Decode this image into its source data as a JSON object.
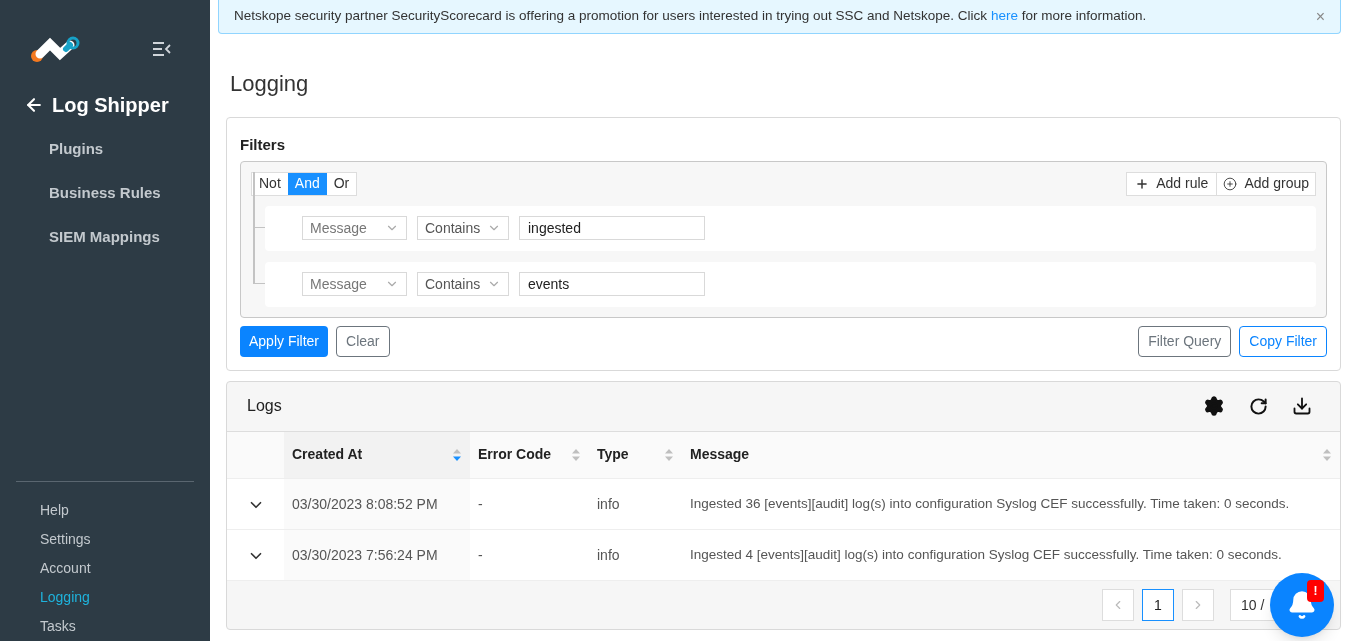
{
  "sidebar": {
    "back_title": "Log Shipper",
    "items": [
      {
        "label": "Plugins"
      },
      {
        "label": "Business Rules"
      },
      {
        "label": "SIEM Mappings"
      }
    ],
    "bottom_items": [
      {
        "label": "Help",
        "selected": false
      },
      {
        "label": "Settings",
        "selected": false
      },
      {
        "label": "Account",
        "selected": false
      },
      {
        "label": "Logging",
        "selected": true
      },
      {
        "label": "Tasks",
        "selected": false
      }
    ]
  },
  "banner": {
    "text": "Netskope security partner SecurityScorecard is offering a promotion for users interested in trying out SSC and Netskope. Click",
    "link": "here",
    "text_after": "for more information.",
    "close": "×"
  },
  "page_title": "Logging",
  "filters": {
    "title": "Filters",
    "combinators": [
      {
        "label": "Not",
        "selected": false
      },
      {
        "label": "And",
        "selected": true
      },
      {
        "label": "Or",
        "selected": false
      }
    ],
    "add_rule": "Add rule",
    "add_group": "Add group",
    "rules": [
      {
        "field": "Message",
        "operator": "Contains",
        "value": "ingested"
      },
      {
        "field": "Message",
        "operator": "Contains",
        "value": "events"
      }
    ],
    "apply": "Apply Filter",
    "clear": "Clear",
    "filter_query": "Filter Query",
    "copy_filter": "Copy Filter"
  },
  "logs": {
    "title": "Logs",
    "columns": [
      {
        "label": "Created At",
        "sorted_descending": true
      },
      {
        "label": "Error Code",
        "sorted_descending": false
      },
      {
        "label": "Type",
        "sorted_descending": false
      },
      {
        "label": "Message",
        "sorted_descending": false
      }
    ],
    "rows": [
      {
        "created_at": "03/30/2023 8:08:52 PM",
        "error_code": "-",
        "type": "info",
        "message": "Ingested 36 [events][audit] log(s) into configuration Syslog CEF successfully. Time taken: 0 seconds."
      },
      {
        "created_at": "03/30/2023 7:56:24 PM",
        "error_code": "-",
        "type": "info",
        "message": "Ingested 4 [events][audit] log(s) into configuration Syslog CEF successfully. Time taken: 0 seconds."
      }
    ],
    "pages": [
      {
        "label": "1",
        "selected": true
      }
    ],
    "page_size": "10 /"
  },
  "notification_badge": "!"
}
